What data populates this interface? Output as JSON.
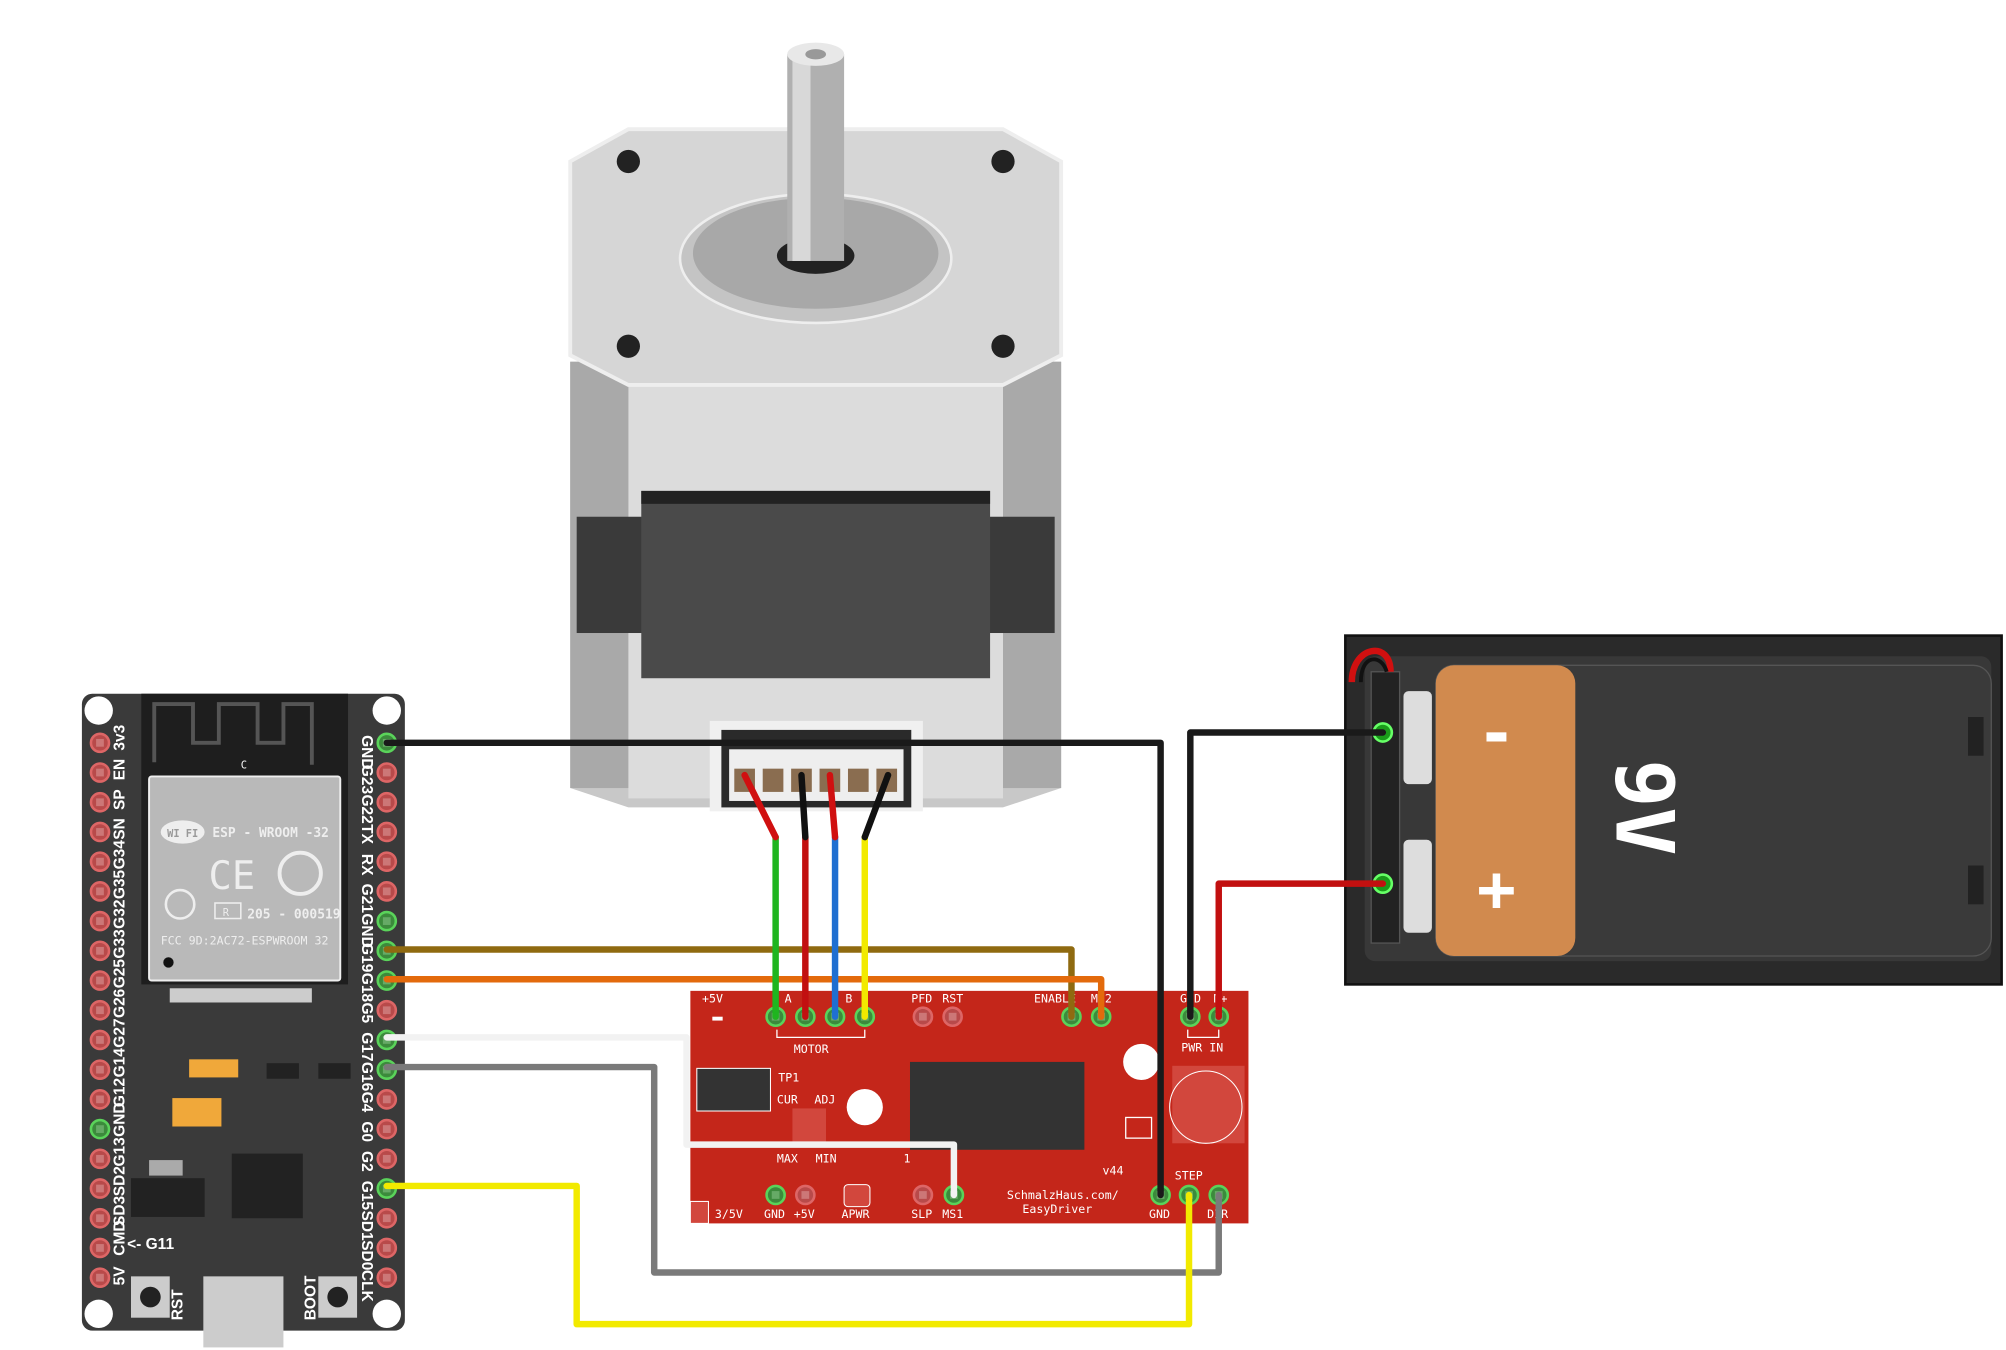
{
  "esp32": {
    "module_name": "ESP - WROOM -32",
    "cert_number": "205 - 000519",
    "fcc": "FCC 9D:2AC72-ESPWROOM 32",
    "antenna_mark": "C",
    "wifi_logo": "WI FI",
    "g11_label": "<- G11",
    "rst_label": "RST",
    "boot_label": "BOOT",
    "left_pins": [
      "3v3",
      "EN",
      "SP",
      "SN",
      "G34",
      "G35",
      "G32",
      "G33",
      "G25",
      "G26",
      "G27",
      "G14",
      "G12",
      "GND",
      "G13",
      "SD2",
      "SD3",
      "CMD",
      "5V"
    ],
    "right_pins": [
      "GND",
      "G23",
      "G22",
      "TX",
      "RX",
      "G21",
      "GND",
      "G19",
      "G18",
      "G5",
      "G17",
      "G16",
      "G4",
      "G0",
      "G2",
      "G15",
      "SD1",
      "SD0",
      "CLK"
    ],
    "connected_left": [
      13
    ],
    "connected_right": [
      0,
      6,
      7,
      8,
      10,
      11,
      15
    ]
  },
  "driver": {
    "top_labels": {
      "v5": "+5V",
      "a": "A",
      "b": "B",
      "pfd": "PFD",
      "rst": "RST",
      "enable": "ENABLE",
      "ms2": "MS2",
      "gnd": "GND",
      "mplus": "M+"
    },
    "motor_label": "MOTOR",
    "pwr_in_label": "PWR IN",
    "tp1": "TP1",
    "cur": "CUR",
    "adj": "ADJ",
    "max": "MAX",
    "min": "MIN",
    "one": "1",
    "version": "v44",
    "brand_line1": "SchmalzHaus.com/",
    "brand_line2": "EasyDriver",
    "bottom_labels": {
      "v35": "3/5V",
      "gnd": "GND",
      "v5": "+5V",
      "apwr": "APWR",
      "slp": "SLP",
      "ms1": "MS1",
      "gnd2": "GND",
      "step": "STEP",
      "dir": "DIR"
    },
    "board_color": "#c4261a"
  },
  "battery": {
    "voltage": "9V",
    "minus": "-",
    "plus": "+"
  },
  "wire_colors": {
    "black": "#1a1a1a",
    "red": "#c21010",
    "green": "#1fb51f",
    "blue": "#1f6fd1",
    "yellow": "#f2ea00",
    "brown": "#8f6a10",
    "orange": "#e36a0c",
    "white": "#f2f2f2",
    "gray": "#7a7a7a"
  }
}
